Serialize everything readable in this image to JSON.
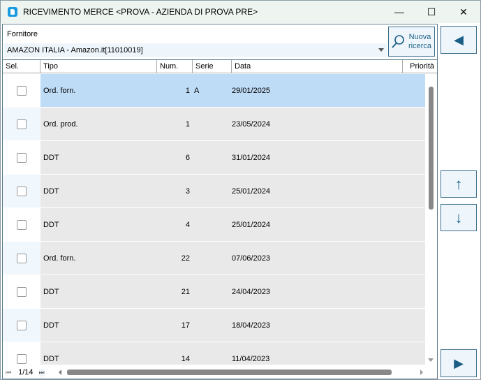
{
  "window": {
    "title": "RICEVIMENTO MERCE <PROVA - AZIENDA DI PROVA PRE>",
    "minimize": "—",
    "maximize": "☐",
    "close": "✕"
  },
  "supplier": {
    "label": "Fornitore",
    "value": "AMAZON ITALIA - Amazon.it[11010019]"
  },
  "search_button": {
    "line1": "Nuova",
    "line2": "ricerca",
    "icon": "search-icon"
  },
  "columns": [
    "Sel.",
    "Tipo",
    "Num.",
    "Serie",
    "Data",
    "Priorità"
  ],
  "rows": [
    {
      "tipo": "Ord. forn.",
      "num": "1",
      "serie": "A",
      "data": "29/01/2025",
      "selected": false
    },
    {
      "tipo": "Ord. prod.",
      "num": "1",
      "serie": "",
      "data": "23/05/2024",
      "selected": false
    },
    {
      "tipo": "DDT",
      "num": "6",
      "serie": "",
      "data": "31/01/2024",
      "selected": false
    },
    {
      "tipo": "DDT",
      "num": "3",
      "serie": "",
      "data": "25/01/2024",
      "selected": false
    },
    {
      "tipo": "DDT",
      "num": "4",
      "serie": "",
      "data": "25/01/2024",
      "selected": false
    },
    {
      "tipo": "Ord. forn.",
      "num": "22",
      "serie": "",
      "data": "07/06/2023",
      "selected": false
    },
    {
      "tipo": "DDT",
      "num": "21",
      "serie": "",
      "data": "24/04/2023",
      "selected": false
    },
    {
      "tipo": "DDT",
      "num": "17",
      "serie": "",
      "data": "18/04/2023",
      "selected": false
    },
    {
      "tipo": "DDT",
      "num": "14",
      "serie": "",
      "data": "11/04/2023",
      "selected": false
    }
  ],
  "pager": {
    "position": "1/14",
    "first": "⏮",
    "last": "⏭"
  },
  "nav": {
    "back": "◀",
    "up": "↑",
    "down": "↓",
    "forward": "▶"
  },
  "colors": {
    "accent": "#1b5e85",
    "highlight": "#bfdcf7"
  }
}
